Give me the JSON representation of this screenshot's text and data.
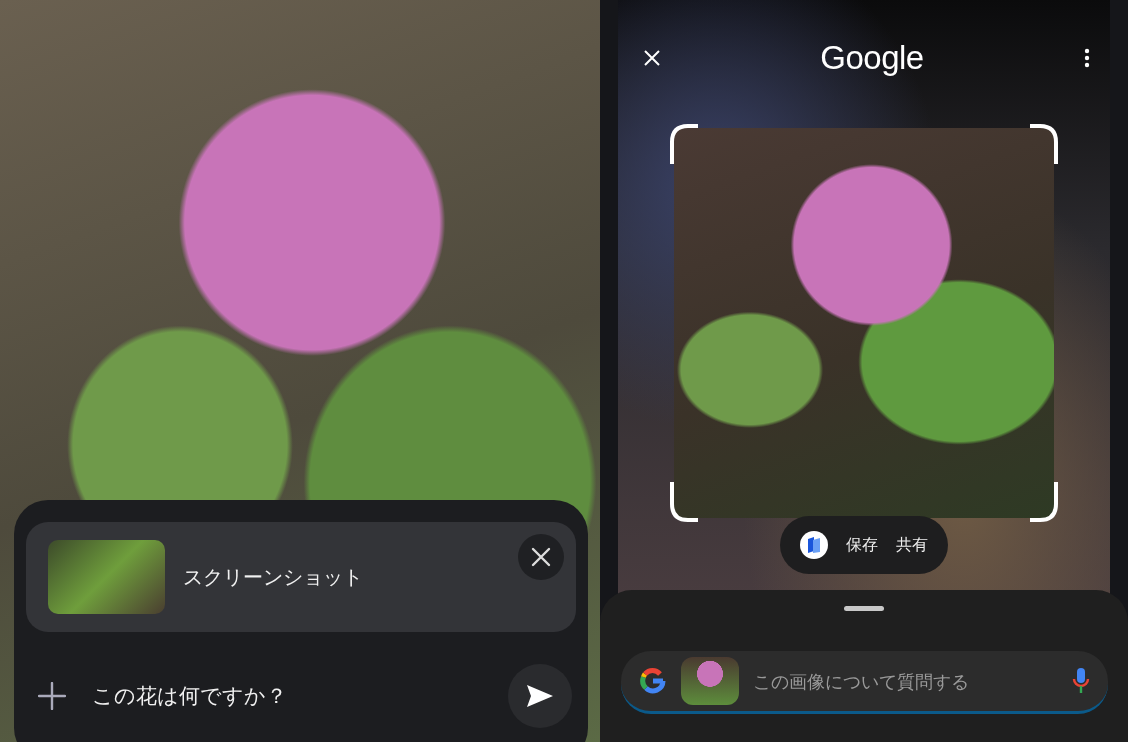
{
  "left": {
    "attachment": {
      "label": "スクリーンショット"
    },
    "prompt": {
      "value": "この花は何ですか？"
    }
  },
  "right": {
    "header": {
      "logo": "Google"
    },
    "actions": [
      "保存",
      "共有"
    ],
    "search": {
      "placeholder": "この画像について質問する"
    }
  }
}
